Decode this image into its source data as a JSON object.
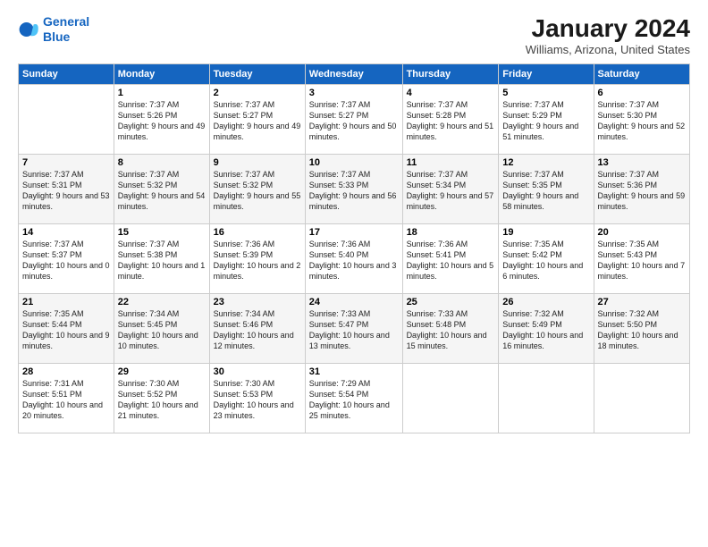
{
  "header": {
    "logo_line1": "General",
    "logo_line2": "Blue",
    "title": "January 2024",
    "location": "Williams, Arizona, United States"
  },
  "columns": [
    "Sunday",
    "Monday",
    "Tuesday",
    "Wednesday",
    "Thursday",
    "Friday",
    "Saturday"
  ],
  "weeks": [
    [
      {
        "day": "",
        "sunrise": "",
        "sunset": "",
        "daylight": ""
      },
      {
        "day": "1",
        "sunrise": "Sunrise: 7:37 AM",
        "sunset": "Sunset: 5:26 PM",
        "daylight": "Daylight: 9 hours and 49 minutes."
      },
      {
        "day": "2",
        "sunrise": "Sunrise: 7:37 AM",
        "sunset": "Sunset: 5:27 PM",
        "daylight": "Daylight: 9 hours and 49 minutes."
      },
      {
        "day": "3",
        "sunrise": "Sunrise: 7:37 AM",
        "sunset": "Sunset: 5:27 PM",
        "daylight": "Daylight: 9 hours and 50 minutes."
      },
      {
        "day": "4",
        "sunrise": "Sunrise: 7:37 AM",
        "sunset": "Sunset: 5:28 PM",
        "daylight": "Daylight: 9 hours and 51 minutes."
      },
      {
        "day": "5",
        "sunrise": "Sunrise: 7:37 AM",
        "sunset": "Sunset: 5:29 PM",
        "daylight": "Daylight: 9 hours and 51 minutes."
      },
      {
        "day": "6",
        "sunrise": "Sunrise: 7:37 AM",
        "sunset": "Sunset: 5:30 PM",
        "daylight": "Daylight: 9 hours and 52 minutes."
      }
    ],
    [
      {
        "day": "7",
        "sunrise": "Sunrise: 7:37 AM",
        "sunset": "Sunset: 5:31 PM",
        "daylight": "Daylight: 9 hours and 53 minutes."
      },
      {
        "day": "8",
        "sunrise": "Sunrise: 7:37 AM",
        "sunset": "Sunset: 5:32 PM",
        "daylight": "Daylight: 9 hours and 54 minutes."
      },
      {
        "day": "9",
        "sunrise": "Sunrise: 7:37 AM",
        "sunset": "Sunset: 5:32 PM",
        "daylight": "Daylight: 9 hours and 55 minutes."
      },
      {
        "day": "10",
        "sunrise": "Sunrise: 7:37 AM",
        "sunset": "Sunset: 5:33 PM",
        "daylight": "Daylight: 9 hours and 56 minutes."
      },
      {
        "day": "11",
        "sunrise": "Sunrise: 7:37 AM",
        "sunset": "Sunset: 5:34 PM",
        "daylight": "Daylight: 9 hours and 57 minutes."
      },
      {
        "day": "12",
        "sunrise": "Sunrise: 7:37 AM",
        "sunset": "Sunset: 5:35 PM",
        "daylight": "Daylight: 9 hours and 58 minutes."
      },
      {
        "day": "13",
        "sunrise": "Sunrise: 7:37 AM",
        "sunset": "Sunset: 5:36 PM",
        "daylight": "Daylight: 9 hours and 59 minutes."
      }
    ],
    [
      {
        "day": "14",
        "sunrise": "Sunrise: 7:37 AM",
        "sunset": "Sunset: 5:37 PM",
        "daylight": "Daylight: 10 hours and 0 minutes."
      },
      {
        "day": "15",
        "sunrise": "Sunrise: 7:37 AM",
        "sunset": "Sunset: 5:38 PM",
        "daylight": "Daylight: 10 hours and 1 minute."
      },
      {
        "day": "16",
        "sunrise": "Sunrise: 7:36 AM",
        "sunset": "Sunset: 5:39 PM",
        "daylight": "Daylight: 10 hours and 2 minutes."
      },
      {
        "day": "17",
        "sunrise": "Sunrise: 7:36 AM",
        "sunset": "Sunset: 5:40 PM",
        "daylight": "Daylight: 10 hours and 3 minutes."
      },
      {
        "day": "18",
        "sunrise": "Sunrise: 7:36 AM",
        "sunset": "Sunset: 5:41 PM",
        "daylight": "Daylight: 10 hours and 5 minutes."
      },
      {
        "day": "19",
        "sunrise": "Sunrise: 7:35 AM",
        "sunset": "Sunset: 5:42 PM",
        "daylight": "Daylight: 10 hours and 6 minutes."
      },
      {
        "day": "20",
        "sunrise": "Sunrise: 7:35 AM",
        "sunset": "Sunset: 5:43 PM",
        "daylight": "Daylight: 10 hours and 7 minutes."
      }
    ],
    [
      {
        "day": "21",
        "sunrise": "Sunrise: 7:35 AM",
        "sunset": "Sunset: 5:44 PM",
        "daylight": "Daylight: 10 hours and 9 minutes."
      },
      {
        "day": "22",
        "sunrise": "Sunrise: 7:34 AM",
        "sunset": "Sunset: 5:45 PM",
        "daylight": "Daylight: 10 hours and 10 minutes."
      },
      {
        "day": "23",
        "sunrise": "Sunrise: 7:34 AM",
        "sunset": "Sunset: 5:46 PM",
        "daylight": "Daylight: 10 hours and 12 minutes."
      },
      {
        "day": "24",
        "sunrise": "Sunrise: 7:33 AM",
        "sunset": "Sunset: 5:47 PM",
        "daylight": "Daylight: 10 hours and 13 minutes."
      },
      {
        "day": "25",
        "sunrise": "Sunrise: 7:33 AM",
        "sunset": "Sunset: 5:48 PM",
        "daylight": "Daylight: 10 hours and 15 minutes."
      },
      {
        "day": "26",
        "sunrise": "Sunrise: 7:32 AM",
        "sunset": "Sunset: 5:49 PM",
        "daylight": "Daylight: 10 hours and 16 minutes."
      },
      {
        "day": "27",
        "sunrise": "Sunrise: 7:32 AM",
        "sunset": "Sunset: 5:50 PM",
        "daylight": "Daylight: 10 hours and 18 minutes."
      }
    ],
    [
      {
        "day": "28",
        "sunrise": "Sunrise: 7:31 AM",
        "sunset": "Sunset: 5:51 PM",
        "daylight": "Daylight: 10 hours and 20 minutes."
      },
      {
        "day": "29",
        "sunrise": "Sunrise: 7:30 AM",
        "sunset": "Sunset: 5:52 PM",
        "daylight": "Daylight: 10 hours and 21 minutes."
      },
      {
        "day": "30",
        "sunrise": "Sunrise: 7:30 AM",
        "sunset": "Sunset: 5:53 PM",
        "daylight": "Daylight: 10 hours and 23 minutes."
      },
      {
        "day": "31",
        "sunrise": "Sunrise: 7:29 AM",
        "sunset": "Sunset: 5:54 PM",
        "daylight": "Daylight: 10 hours and 25 minutes."
      },
      {
        "day": "",
        "sunrise": "",
        "sunset": "",
        "daylight": ""
      },
      {
        "day": "",
        "sunrise": "",
        "sunset": "",
        "daylight": ""
      },
      {
        "day": "",
        "sunrise": "",
        "sunset": "",
        "daylight": ""
      }
    ]
  ]
}
